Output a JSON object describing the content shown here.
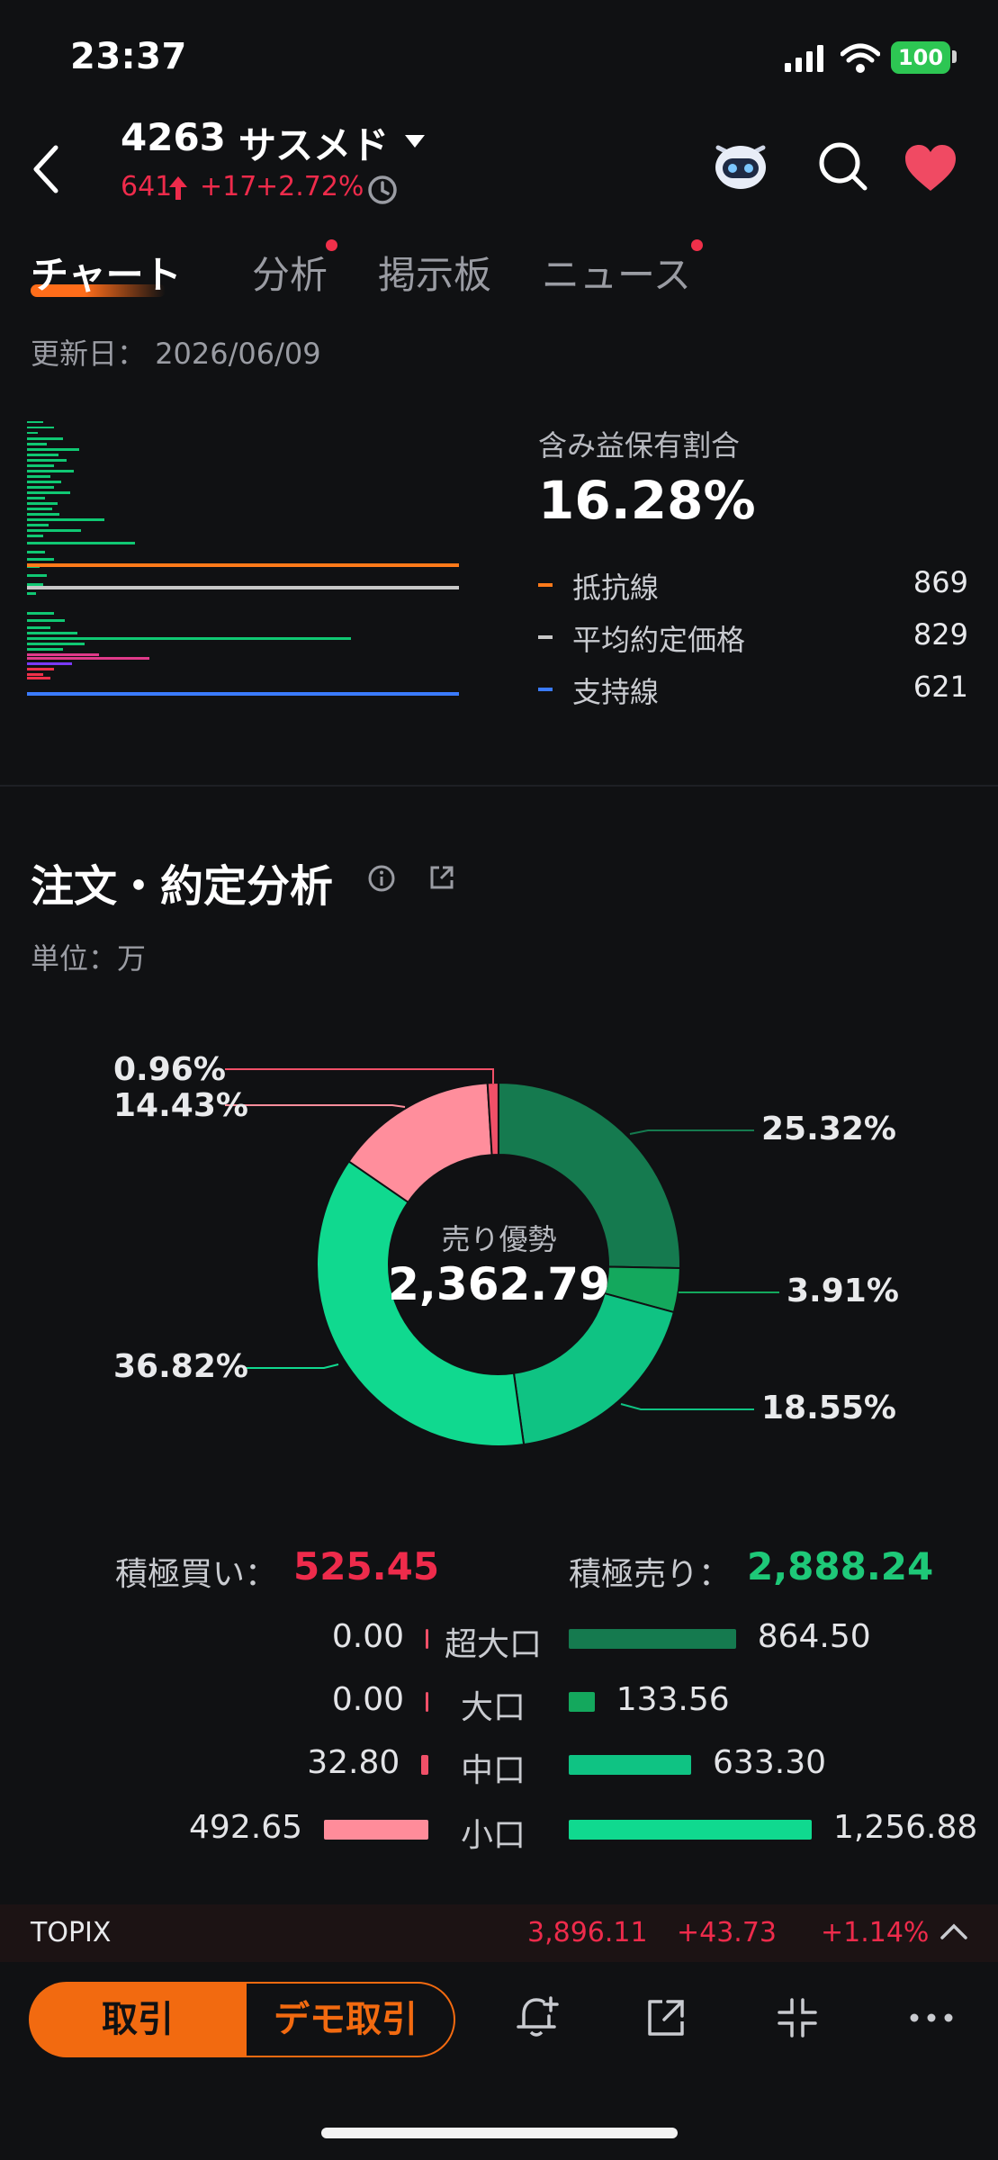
{
  "status_bar": {
    "time": "23:37",
    "battery": "100"
  },
  "header": {
    "code": "4263",
    "name": "サスメド",
    "price": "641",
    "change": "+17",
    "change_pct": "+2.72%",
    "icons": [
      "back-icon",
      "chevron-down-icon",
      "clock-icon",
      "robot-icon",
      "search-icon",
      "heart-icon"
    ]
  },
  "tabs": [
    {
      "label": "チャート",
      "active": true,
      "dot": false
    },
    {
      "label": "分析",
      "active": false,
      "dot": true
    },
    {
      "label": "掲示板",
      "active": false,
      "dot": false
    },
    {
      "label": "ニュース",
      "active": false,
      "dot": true
    }
  ],
  "update": {
    "label": "更新日：",
    "date": "2026/06/09"
  },
  "chip": {
    "title": "含み益保有割合",
    "value": "16.28%",
    "legend": [
      {
        "label": "抵抗線",
        "value": "869",
        "color": "#ff7a1a"
      },
      {
        "label": "平均約定価格",
        "value": "829",
        "color": "#c8c8c8"
      },
      {
        "label": "支持線",
        "value": "621",
        "color": "#3a7bff"
      }
    ]
  },
  "order_analysis": {
    "title": "注文・約定分析",
    "unit": "単位：万",
    "center_label": "売り優勢",
    "center_value": "2,362.79",
    "donut": [
      {
        "pct": "25.32%",
        "value": 25.32,
        "color": "#157a4f"
      },
      {
        "pct": "3.91%",
        "value": 3.91,
        "color": "#14a85d"
      },
      {
        "pct": "18.55%",
        "value": 18.55,
        "color": "#0fc383"
      },
      {
        "pct": "36.82%",
        "value": 36.82,
        "color": "#10d98f"
      },
      {
        "pct": "14.43%",
        "value": 14.43,
        "color": "#ff8e9c"
      },
      {
        "pct": "0.96%",
        "value": 0.96,
        "color": "#f05068"
      }
    ],
    "buy_label": "積極買い：",
    "buy_total": "525.45",
    "sell_label": "積極売り：",
    "sell_total": "2,888.24",
    "rows": [
      {
        "cat": "超大口",
        "buy": "0.00",
        "buy_value": 0.0,
        "sell": "864.50",
        "sell_value": 864.5,
        "sell_color": "#157a4f"
      },
      {
        "cat": "大口",
        "buy": "0.00",
        "buy_value": 0.0,
        "sell": "133.56",
        "sell_value": 133.56,
        "sell_color": "#14a85d"
      },
      {
        "cat": "中口",
        "buy": "32.80",
        "buy_value": 32.8,
        "sell": "633.30",
        "sell_value": 633.3,
        "sell_color": "#0fc383"
      },
      {
        "cat": "小口",
        "buy": "492.65",
        "buy_value": 492.65,
        "sell": "1,256.88",
        "sell_value": 1256.88,
        "sell_color": "#10d98f"
      }
    ]
  },
  "ticker": {
    "name": "TOPIX",
    "price": "3,896.11",
    "change": "+43.73",
    "change_pct": "+1.14%"
  },
  "bottom": {
    "trade": "取引",
    "demo": "デモ取引",
    "icons": [
      "bell-plus-icon",
      "share-icon",
      "compress-icon",
      "more-icon"
    ]
  }
}
